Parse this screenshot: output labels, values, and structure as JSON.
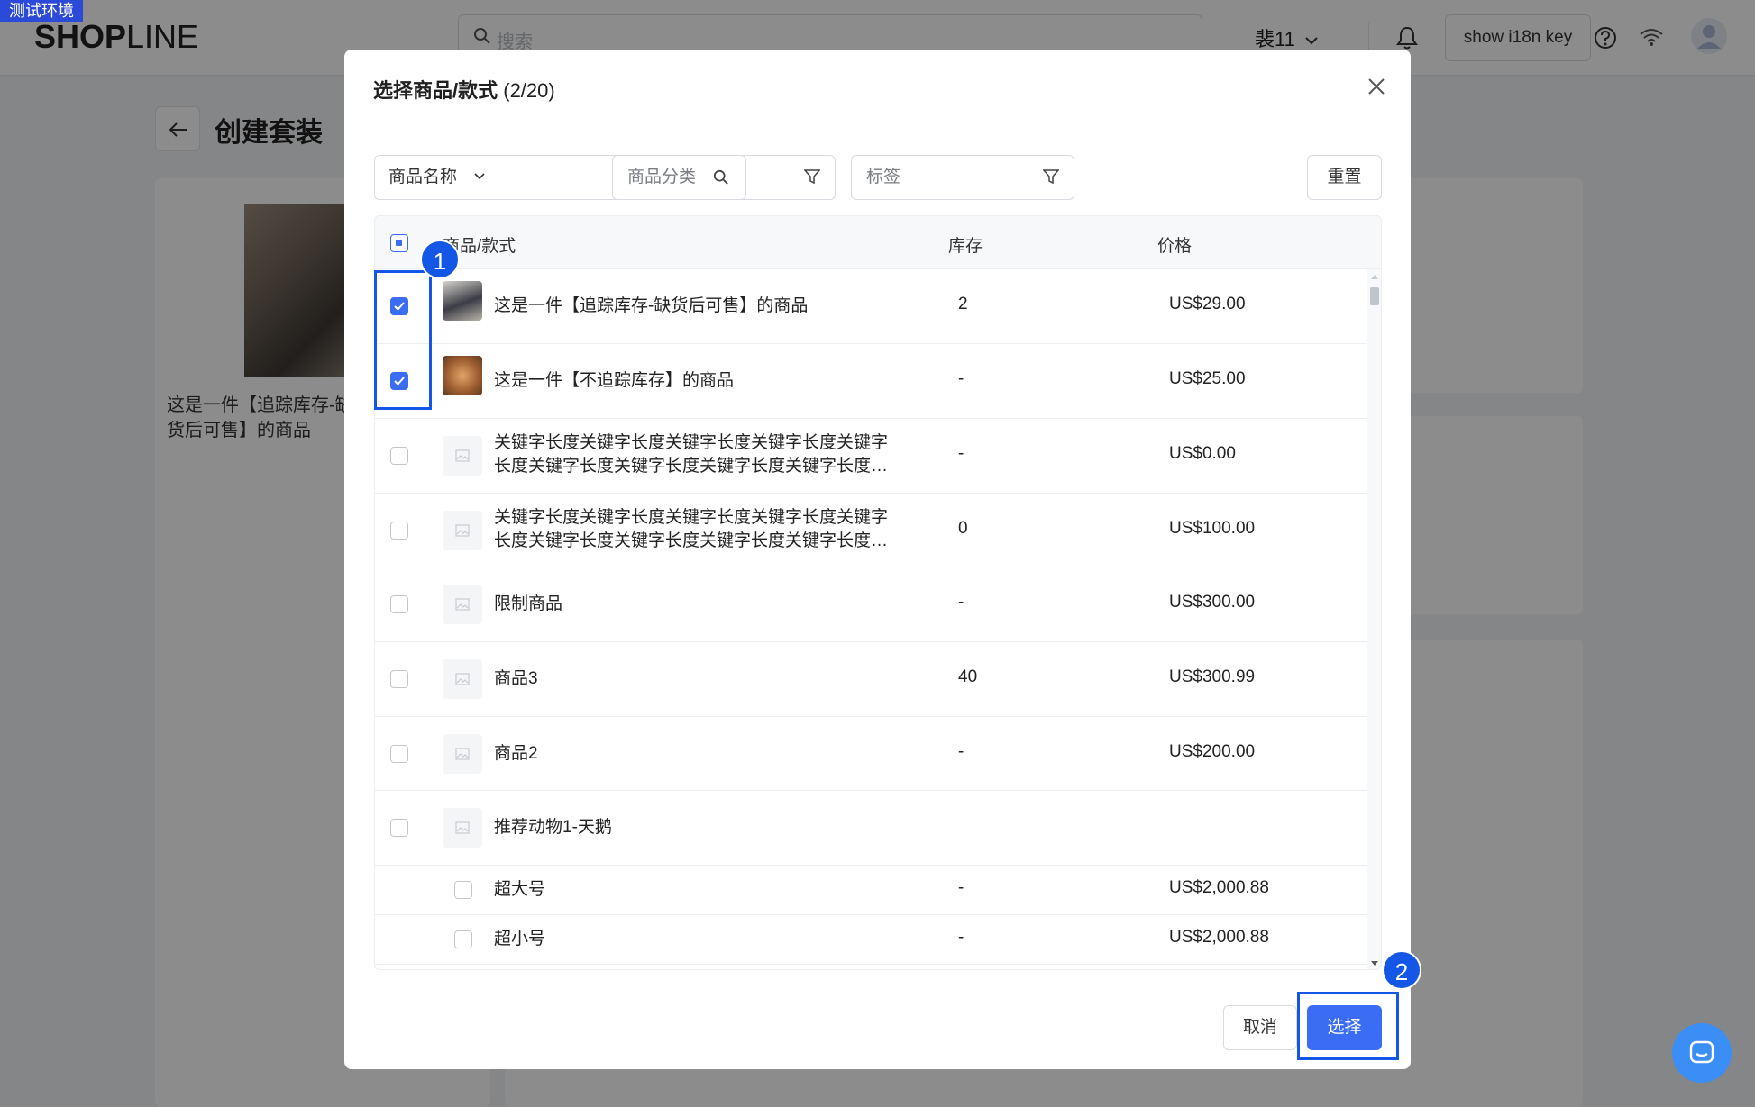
{
  "env_tag": "测试环境",
  "topbar": {
    "logo_bold": "SHOP",
    "logo_thin": "LINE",
    "search_placeholder": "搜索",
    "store_name": "裴11",
    "i18n_button": "show i18n key"
  },
  "page": {
    "title": "创建套装",
    "selected_product_name": "这是一件【追踪库存-缺货后可售】的商品"
  },
  "modal": {
    "title": "选择商品/款式",
    "count": "(2/20)",
    "search_field_label": "商品名称",
    "search_value": "",
    "category_filter": "商品分类",
    "tag_filter": "标签",
    "reset_button": "重置",
    "columns": {
      "name": "商品/款式",
      "stock": "库存",
      "price": "价格"
    },
    "rows": [
      {
        "name": "这是一件【追踪库存-缺货后可售】的商品",
        "stock": "2",
        "price": "US$29.00",
        "checked": true,
        "thumb": "photo"
      },
      {
        "name": "这是一件【不追踪库存】的商品",
        "stock": "-",
        "price": "US$25.00",
        "checked": true,
        "thumb": "photo"
      },
      {
        "name": "关键字长度关键字长度关键字长度关键字长度关键字长度关键字长度关键字长度关键字长度关键字长度关键字长度",
        "stock": "-",
        "price": "US$0.00",
        "checked": false,
        "thumb": "placeholder"
      },
      {
        "name": "关键字长度关键字长度关键字长度关键字长度关键字长度关键字长度关键字长度关键字长度关键字长度关键字长度",
        "stock": "0",
        "price": "US$100.00",
        "checked": false,
        "thumb": "placeholder"
      },
      {
        "name": "限制商品",
        "stock": "-",
        "price": "US$300.00",
        "checked": false,
        "thumb": "placeholder"
      },
      {
        "name": "商品3",
        "stock": "40",
        "price": "US$300.99",
        "checked": false,
        "thumb": "placeholder"
      },
      {
        "name": "商品2",
        "stock": "-",
        "price": "US$200.00",
        "checked": false,
        "thumb": "placeholder"
      },
      {
        "name": "推荐动物1-天鹅",
        "stock": "",
        "price": "",
        "checked": false,
        "thumb": "placeholder"
      }
    ],
    "variants": [
      {
        "name": "超大号",
        "stock": "-",
        "price": "US$2,000.88",
        "checked": false
      },
      {
        "name": "超小号",
        "stock": "-",
        "price": "US$2,000.88",
        "checked": false
      }
    ],
    "cancel_button": "取消",
    "select_button": "选择"
  },
  "annotations": {
    "badge_1": "1",
    "badge_2": "2"
  },
  "colors": {
    "primary": "#3a6cf4",
    "highlight": "#1456e6"
  }
}
